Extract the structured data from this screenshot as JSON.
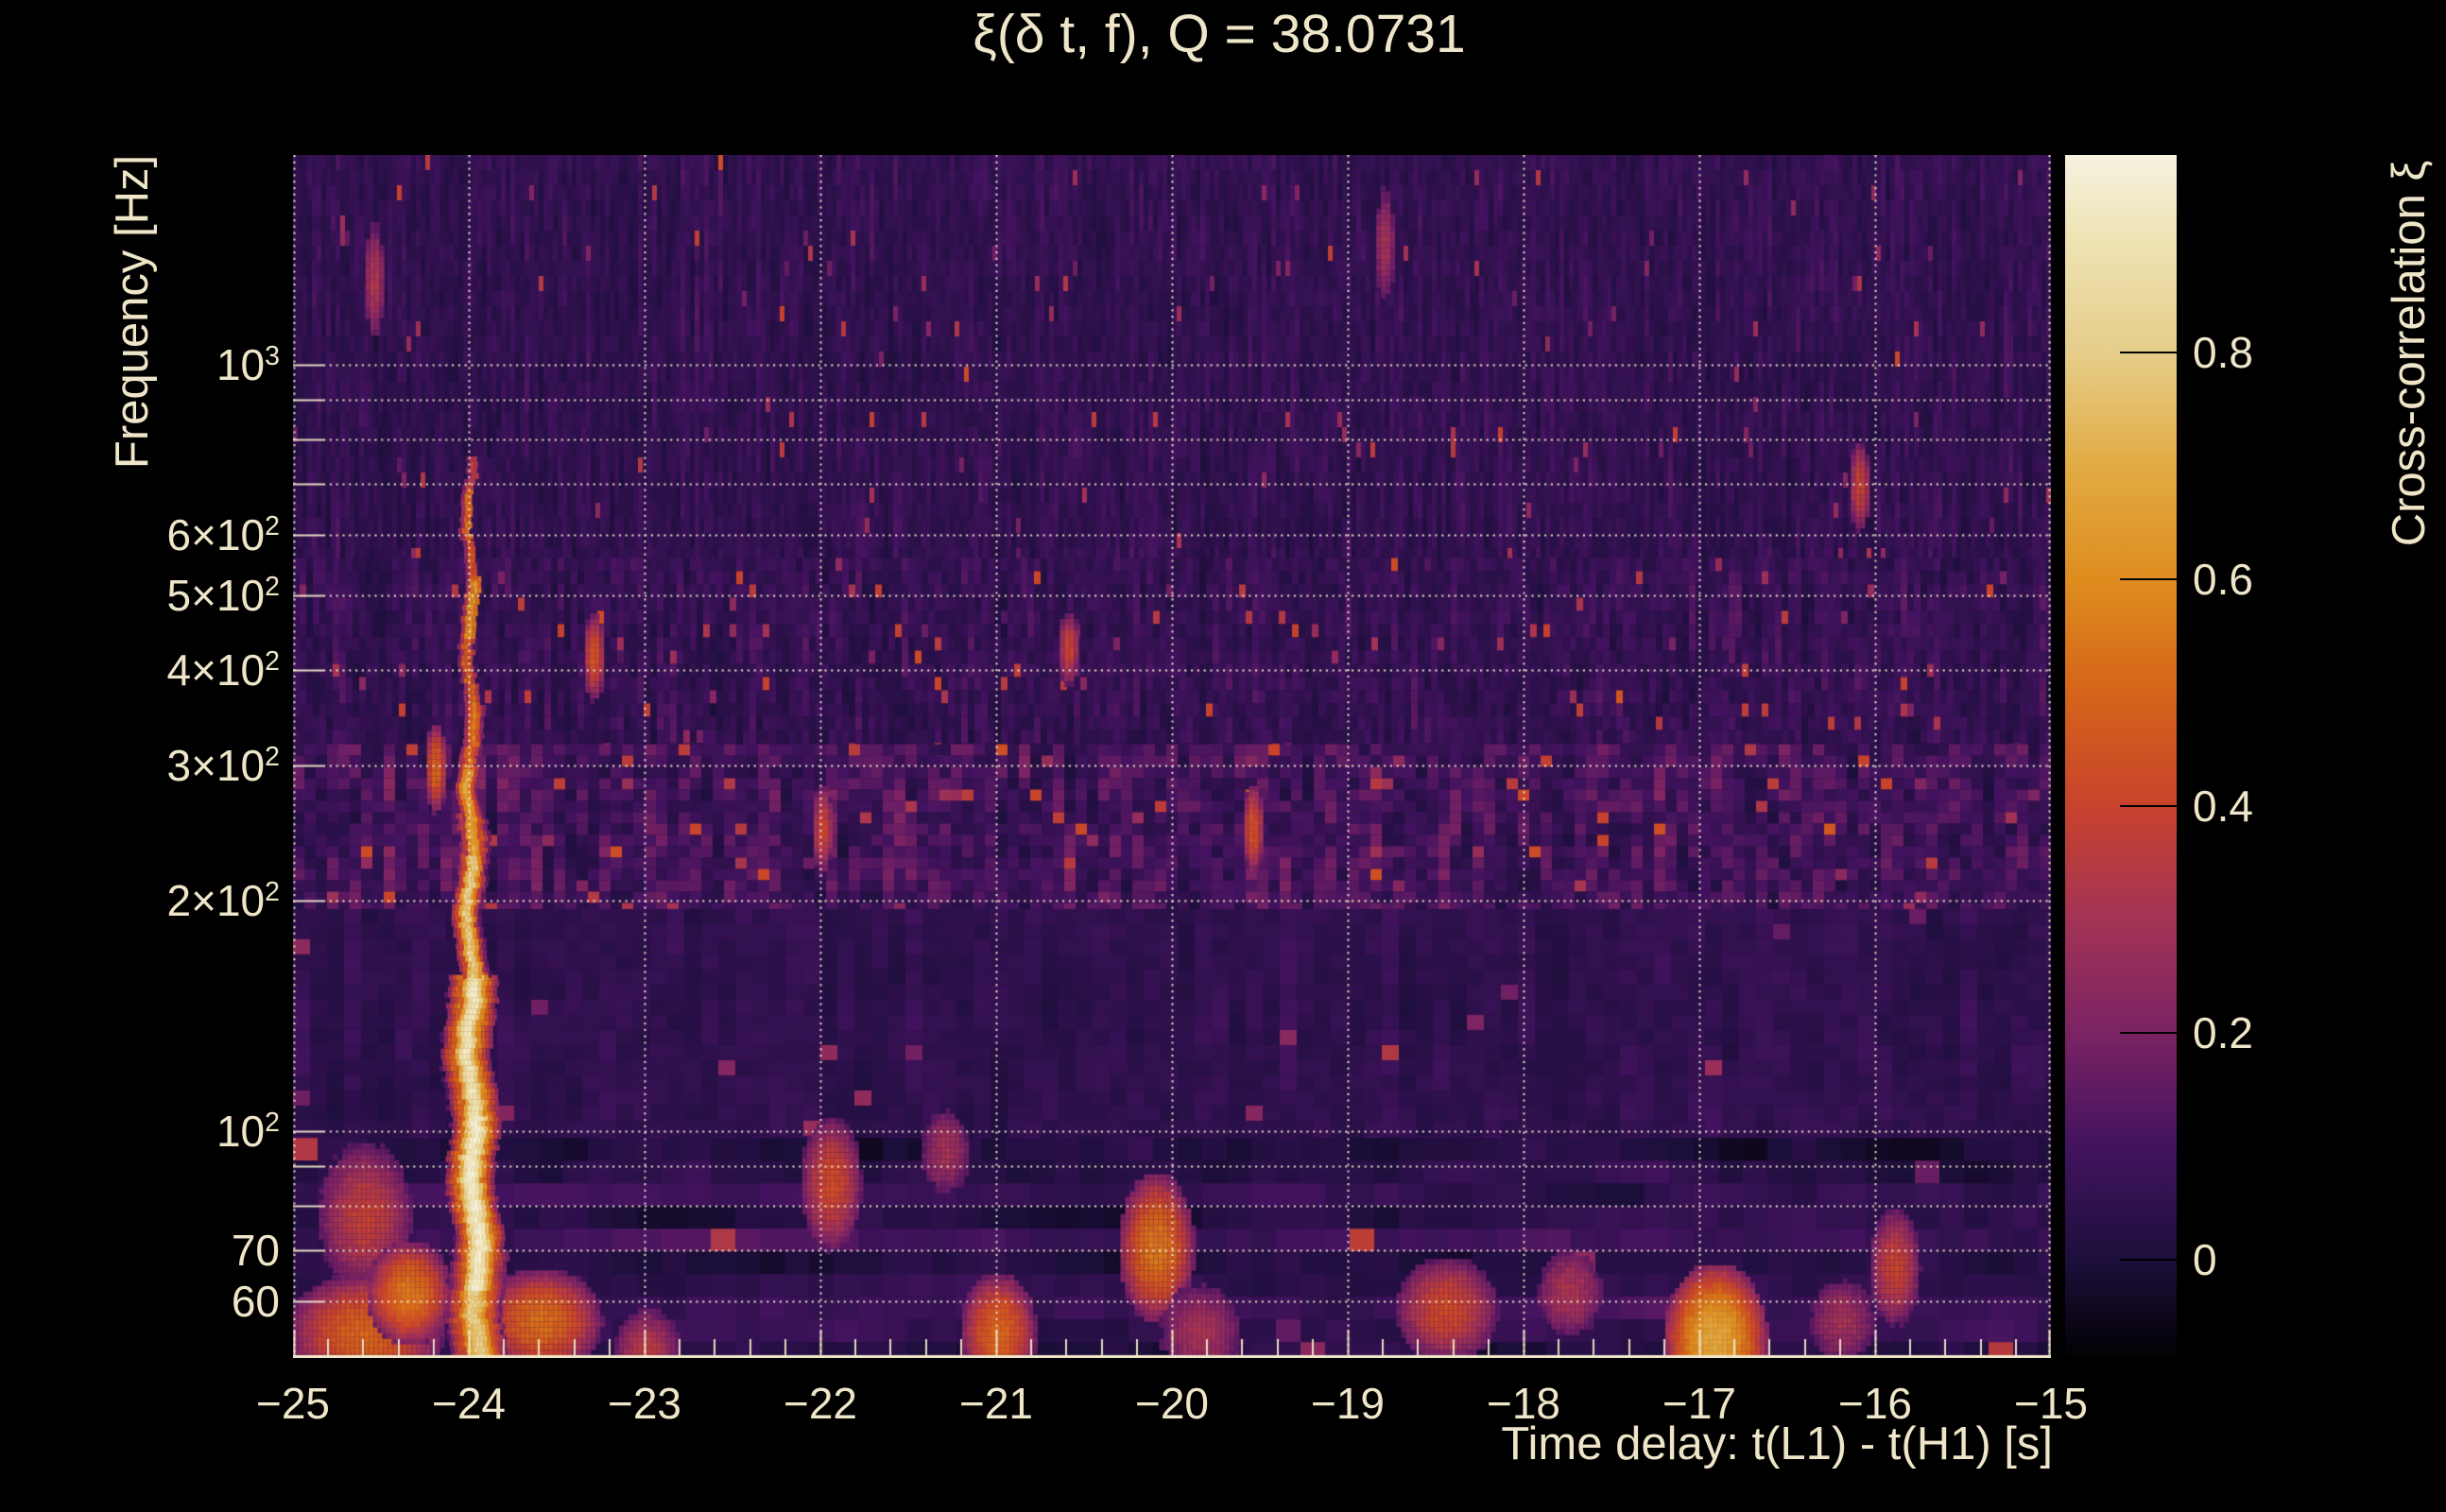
{
  "colors": {
    "background": "#000000",
    "foreground": "#efe6c9"
  },
  "chart_data": {
    "type": "heatmap",
    "title": "ξ(δ t, f), Q = 38.0731",
    "xlabel": "Time delay: t(L1) - t(H1) [s]",
    "ylabel": "Frequency [Hz]",
    "seed": 1337,
    "x": {
      "min": -25,
      "max": -15,
      "minor_step": 0.2,
      "ticks": [
        {
          "t": -25,
          "label": "−25"
        },
        {
          "t": -24,
          "label": "−24"
        },
        {
          "t": -23,
          "label": "−23"
        },
        {
          "t": -22,
          "label": "−22"
        },
        {
          "t": -21,
          "label": "−21"
        },
        {
          "t": -20,
          "label": "−20"
        },
        {
          "t": -19,
          "label": "−19"
        },
        {
          "t": -18,
          "label": "−18"
        },
        {
          "t": -17,
          "label": "−17"
        },
        {
          "t": -16,
          "label": "−16"
        },
        {
          "t": -15,
          "label": "−15"
        }
      ]
    },
    "y": {
      "scale": "log",
      "fmin": 50.6,
      "fmax": 1880,
      "grid": [
        1000,
        900,
        800,
        700,
        600,
        500,
        400,
        300,
        200,
        100,
        90,
        80,
        70,
        60
      ],
      "ticks": [
        {
          "f": 1000,
          "base": "10",
          "exp": "3"
        },
        {
          "f": 600,
          "base": "6×10",
          "exp": "2"
        },
        {
          "f": 500,
          "base": "5×10",
          "exp": "2"
        },
        {
          "f": 400,
          "base": "4×10",
          "exp": "2"
        },
        {
          "f": 300,
          "base": "3×10",
          "exp": "2"
        },
        {
          "f": 200,
          "base": "2×10",
          "exp": "2"
        },
        {
          "f": 100,
          "base": "10",
          "exp": "2"
        },
        {
          "f": 70,
          "base": "70"
        },
        {
          "f": 60,
          "base": "60"
        }
      ]
    },
    "colorbar": {
      "label": "Cross-correlation ξ",
      "vmin": -0.087,
      "vmax": 0.974,
      "ticks": [
        {
          "v": 0.8,
          "label": "0.8"
        },
        {
          "v": 0.6,
          "label": "0.6"
        },
        {
          "v": 0.4,
          "label": "0.4"
        },
        {
          "v": 0.2,
          "label": "0.2"
        },
        {
          "v": 0,
          "label": "0"
        }
      ],
      "stops": [
        [
          -0.087,
          "#020103"
        ],
        [
          0.0,
          "#1d0f3c"
        ],
        [
          0.1,
          "#43135f"
        ],
        [
          0.2,
          "#7b2364"
        ],
        [
          0.3,
          "#a33355"
        ],
        [
          0.4,
          "#c8432c"
        ],
        [
          0.5,
          "#d5641a"
        ],
        [
          0.6,
          "#de8d1e"
        ],
        [
          0.7,
          "#e2ab44"
        ],
        [
          0.8,
          "#e5cd8a"
        ],
        [
          0.9,
          "#efe3b4"
        ],
        [
          0.974,
          "#f5f2e0"
        ]
      ]
    },
    "texture": [
      {
        "f0": 560,
        "f1": 1880,
        "cw": 5,
        "ch": 16,
        "mean": 0.055,
        "varr": 0.065,
        "ar": 0.55,
        "p": 0.012,
        "spike": 0.22,
        "dir": "v"
      },
      {
        "f0": 320,
        "f1": 560,
        "cw": 7,
        "ch": 14,
        "mean": 0.06,
        "varr": 0.075,
        "ar": 0.5,
        "p": 0.02,
        "spike": 0.24,
        "dir": "v"
      },
      {
        "f0": 195,
        "f1": 320,
        "cw": 12,
        "ch": 12,
        "mean": 0.09,
        "varr": 0.11,
        "ar": 0.45,
        "p": 0.03,
        "spike": 0.22,
        "dir": "v"
      },
      {
        "f0": 98,
        "f1": 195,
        "cw": 18,
        "ch": 16,
        "mean": 0.045,
        "varr": 0.05,
        "ar": 0.6,
        "p": 0.008,
        "spike": 0.18,
        "dir": "v"
      },
      {
        "f0": 50,
        "f1": 98,
        "cw": 26,
        "ch": 24,
        "mean": 0.05,
        "varr": 0.09,
        "ar": 0.65,
        "p": 0.02,
        "spike": 0.25,
        "dir": "h"
      }
    ],
    "features": [
      {
        "t": -24.6,
        "f": 78,
        "rt": 0.28,
        "rf": 0.1,
        "v": 0.38
      },
      {
        "t": -24.6,
        "f": 55,
        "rt": 0.45,
        "rf": 0.08,
        "v": 0.5
      },
      {
        "t": -24.35,
        "f": 62,
        "rt": 0.25,
        "rf": 0.07,
        "v": 0.55
      },
      {
        "t": -23.6,
        "f": 57,
        "rt": 0.35,
        "rf": 0.07,
        "v": 0.52
      },
      {
        "t": -23.0,
        "f": 52,
        "rt": 0.2,
        "rf": 0.06,
        "v": 0.35
      },
      {
        "t": -21.95,
        "f": 86,
        "rt": 0.18,
        "rf": 0.09,
        "v": 0.42
      },
      {
        "t": -21.3,
        "f": 95,
        "rt": 0.15,
        "rf": 0.06,
        "v": 0.3
      },
      {
        "t": -21.0,
        "f": 55,
        "rt": 0.22,
        "rf": 0.08,
        "v": 0.5
      },
      {
        "t": -20.1,
        "f": 71,
        "rt": 0.22,
        "rf": 0.1,
        "v": 0.55
      },
      {
        "t": -19.85,
        "f": 55,
        "rt": 0.25,
        "rf": 0.07,
        "v": 0.3
      },
      {
        "t": -18.45,
        "f": 59,
        "rt": 0.3,
        "rf": 0.07,
        "v": 0.42
      },
      {
        "t": -17.75,
        "f": 62,
        "rt": 0.2,
        "rf": 0.06,
        "v": 0.32
      },
      {
        "t": -16.92,
        "f": 54,
        "rt": 0.3,
        "rf": 0.1,
        "v": 0.68
      },
      {
        "t": -16.2,
        "f": 57,
        "rt": 0.2,
        "rf": 0.06,
        "v": 0.3
      },
      {
        "t": -15.9,
        "f": 67,
        "rt": 0.15,
        "rf": 0.08,
        "v": 0.4
      },
      {
        "t": -22.0,
        "f": 250,
        "rt": 0.06,
        "rf": 0.06,
        "v": 0.4
      },
      {
        "t": -19.55,
        "f": 250,
        "rt": 0.06,
        "rf": 0.06,
        "v": 0.45
      },
      {
        "t": -24.2,
        "f": 300,
        "rt": 0.05,
        "rf": 0.06,
        "v": 0.5
      },
      {
        "t": -23.3,
        "f": 420,
        "rt": 0.05,
        "rf": 0.06,
        "v": 0.45
      },
      {
        "t": -20.6,
        "f": 430,
        "rt": 0.05,
        "rf": 0.05,
        "v": 0.4
      },
      {
        "t": -16.1,
        "f": 700,
        "rt": 0.05,
        "rf": 0.06,
        "v": 0.4
      },
      {
        "t": -24.55,
        "f": 1300,
        "rt": 0.04,
        "rf": 0.08,
        "v": 0.33
      },
      {
        "t": -18.8,
        "f": 1450,
        "rt": 0.04,
        "rf": 0.08,
        "v": 0.3
      }
    ],
    "chirp": {
      "t": -24.0,
      "halo": [
        {
          "f0": 50,
          "f1": 70,
          "hw": 0.17,
          "v": 0.6
        },
        {
          "f0": 70,
          "f1": 160,
          "hw": 0.15,
          "v": 0.68
        },
        {
          "f0": 160,
          "f1": 260,
          "hw": 0.09,
          "v": 0.55
        },
        {
          "f0": 260,
          "f1": 360,
          "hw": 0.06,
          "v": 0.45
        }
      ],
      "core": [
        {
          "f0": 50,
          "f1": 62,
          "hw": 0.09,
          "v": 0.8
        },
        {
          "f0": 62,
          "f1": 105,
          "hw": 0.08,
          "v": 0.95
        },
        {
          "f0": 105,
          "f1": 160,
          "hw": 0.07,
          "v": 0.92
        },
        {
          "f0": 160,
          "f1": 230,
          "hw": 0.05,
          "v": 0.8
        },
        {
          "f0": 230,
          "f1": 300,
          "hw": 0.045,
          "v": 0.68
        },
        {
          "f0": 300,
          "f1": 370,
          "hw": 0.04,
          "v": 0.55
        },
        {
          "f0": 370,
          "f1": 440,
          "hw": 0.035,
          "v": 0.5
        },
        {
          "f0": 440,
          "f1": 530,
          "hw": 0.04,
          "v": 0.63
        },
        {
          "f0": 530,
          "f1": 600,
          "hw": 0.03,
          "v": 0.45
        },
        {
          "f0": 600,
          "f1": 690,
          "hw": 0.032,
          "v": 0.52
        },
        {
          "f0": 690,
          "f1": 760,
          "hw": 0.028,
          "v": 0.38
        }
      ]
    }
  }
}
